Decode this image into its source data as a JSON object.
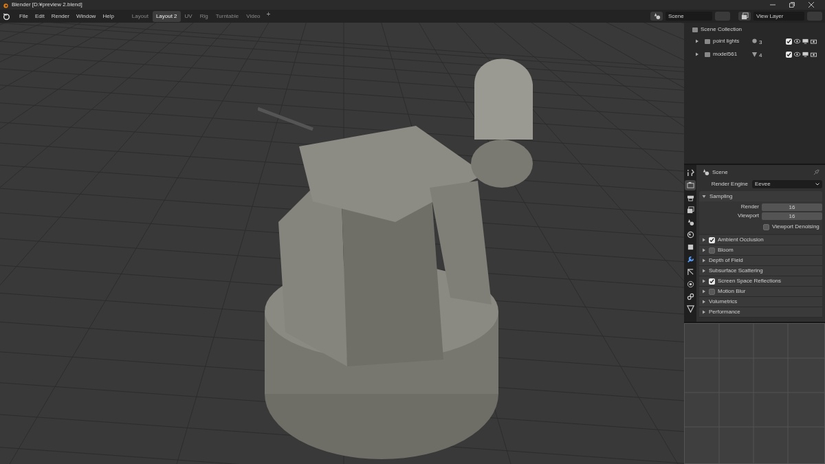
{
  "window": {
    "title": "Blender [D:¥preview 2.blend]"
  },
  "menu": [
    "File",
    "Edit",
    "Render",
    "Window",
    "Help"
  ],
  "workspaces": [
    {
      "label": "Layout",
      "selected": false
    },
    {
      "label": "Layout 2",
      "selected": true
    },
    {
      "label": "UV",
      "selected": false
    },
    {
      "label": "Rig",
      "selected": false
    },
    {
      "label": "Turntable",
      "selected": false
    },
    {
      "label": "Video",
      "selected": false
    }
  ],
  "add_workspace": "+",
  "scene_field": {
    "value": "Scene"
  },
  "view_layer_field": {
    "value": "View Layer"
  },
  "outliner": {
    "root": "Scene Collection",
    "items": [
      {
        "name": "point lights",
        "kind": "light",
        "count": "3",
        "checked": true
      },
      {
        "name": "model561",
        "kind": "mesh",
        "count": "4",
        "checked": true
      }
    ]
  },
  "properties": {
    "tabs": [
      {
        "kind": "tool",
        "selected": false
      },
      {
        "kind": "render",
        "selected": true
      },
      {
        "kind": "output",
        "selected": false
      },
      {
        "kind": "view",
        "selected": false
      },
      {
        "kind": "scene",
        "selected": false
      },
      {
        "kind": "world",
        "selected": false
      },
      {
        "kind": "object",
        "selected": false
      },
      {
        "kind": "modifier",
        "selected": false
      },
      {
        "kind": "particles",
        "selected": false
      },
      {
        "kind": "physics",
        "selected": false
      },
      {
        "kind": "constraints",
        "selected": false
      },
      {
        "kind": "data",
        "selected": false
      }
    ],
    "context": "Scene",
    "render_engine": {
      "label": "Render Engine",
      "value": "Eevee"
    },
    "sampling": {
      "title": "Sampling",
      "expanded": true,
      "fields": [
        {
          "label": "Render",
          "value": "16"
        },
        {
          "label": "Viewport",
          "value": "16"
        }
      ],
      "denoise": {
        "label": "Viewport Denoising",
        "checked": false
      }
    },
    "panels": [
      {
        "title": "Ambient Occlusion",
        "kind": "toggle",
        "checked": true
      },
      {
        "title": "Bloom",
        "kind": "toggle",
        "checked": false
      },
      {
        "title": "Depth of Field",
        "kind": "plain"
      },
      {
        "title": "Subsurface Scattering",
        "kind": "plain"
      },
      {
        "title": "Screen Space Reflections",
        "kind": "toggle",
        "checked": true
      },
      {
        "title": "Motion Blur",
        "kind": "toggle",
        "checked": false
      },
      {
        "title": "Volumetrics",
        "kind": "plain"
      },
      {
        "title": "Performance",
        "kind": "plain"
      }
    ]
  }
}
